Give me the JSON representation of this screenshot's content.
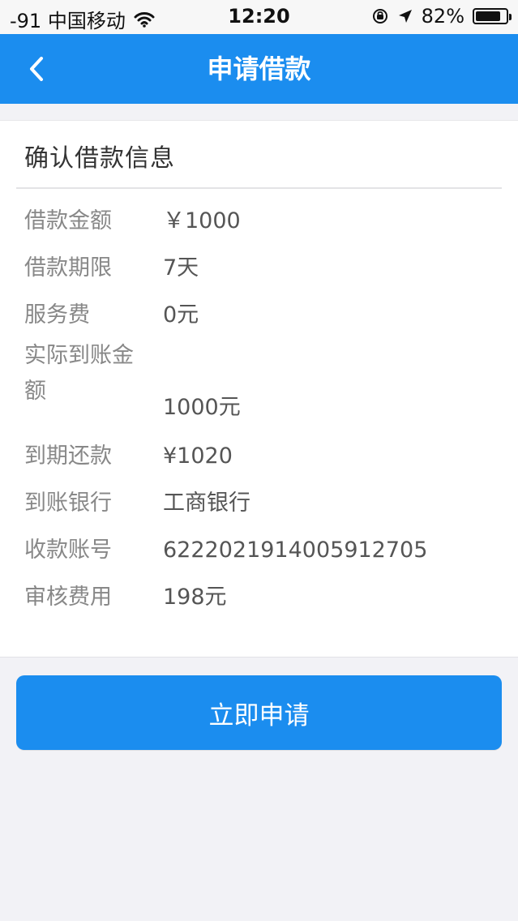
{
  "status_bar": {
    "carrier": "-91 中国移动",
    "time": "12:20",
    "battery": "82%",
    "battery_level": 82
  },
  "nav": {
    "title": "申请借款"
  },
  "card": {
    "title": "确认借款信息",
    "rows": [
      {
        "label": "借款金额",
        "value": "￥1000"
      },
      {
        "label": "借款期限",
        "value": "7天"
      },
      {
        "label": "服务费",
        "value": "0元"
      },
      {
        "label": "实际到账金额",
        "value": "1000元"
      },
      {
        "label": "到期还款",
        "value": "¥1020"
      },
      {
        "label": "到账银行",
        "value": "工商银行"
      },
      {
        "label": "收款账号",
        "value": "6222021914005912705"
      },
      {
        "label": "审核费用",
        "value": "198元"
      }
    ]
  },
  "submit": {
    "label": "立即申请"
  },
  "colors": {
    "primary": "#1b8def",
    "background": "#f2f2f6",
    "label": "#888888",
    "value": "#555555"
  },
  "icons": {
    "back": "chevron-left-icon",
    "wifi": "wifi-icon",
    "orientation_lock": "orientation-lock-icon",
    "location": "location-arrow-icon",
    "battery": "battery-icon"
  }
}
